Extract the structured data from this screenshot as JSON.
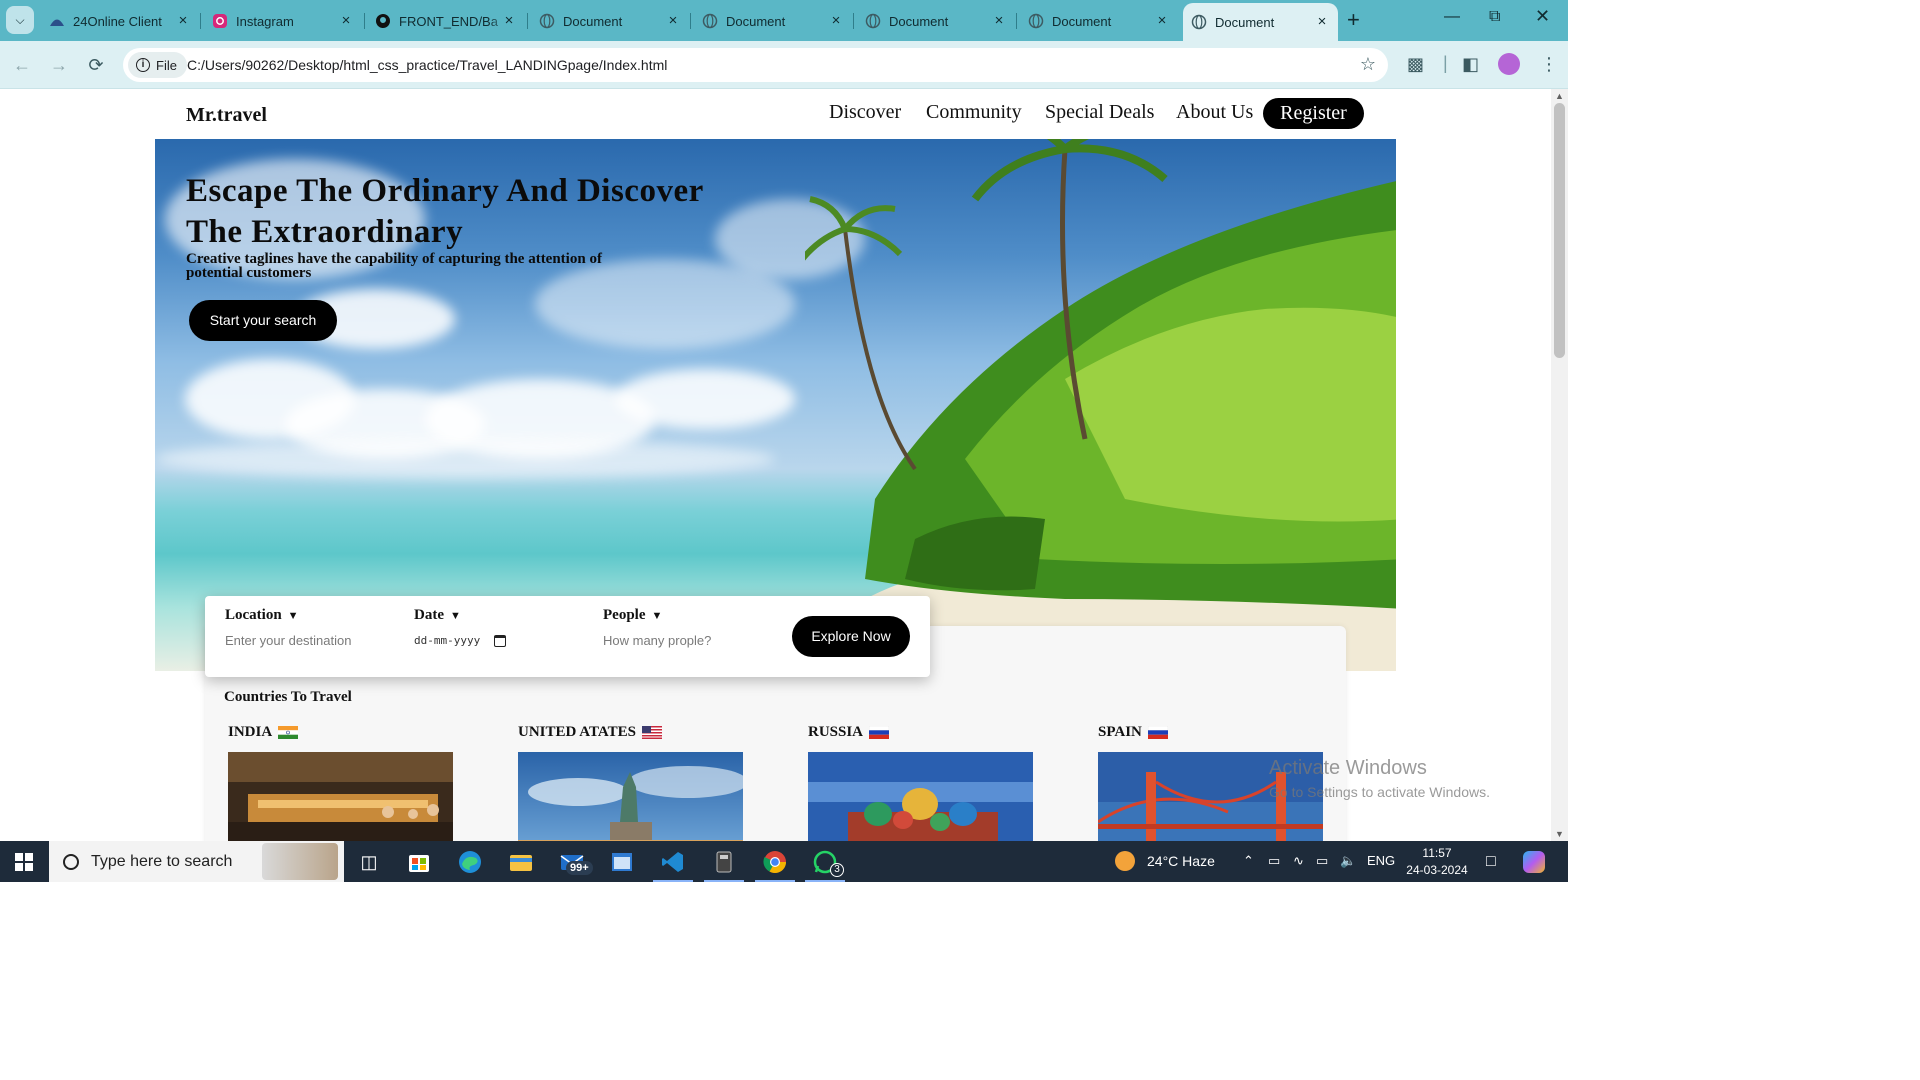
{
  "browser": {
    "tabs": [
      {
        "title": "24Online Client",
        "icon": "globe-icon"
      },
      {
        "title": "Instagram",
        "icon": "instagram-icon"
      },
      {
        "title": "FRONT_END/Ba",
        "icon": "github-icon"
      },
      {
        "title": "Document",
        "icon": "globe-icon"
      },
      {
        "title": "Document",
        "icon": "globe-icon"
      },
      {
        "title": "Document",
        "icon": "globe-icon"
      },
      {
        "title": "Document",
        "icon": "globe-icon"
      },
      {
        "title": "Document",
        "icon": "globe-icon",
        "active": true
      }
    ],
    "security_chip": "File",
    "url": "C:/Users/90262/Desktop/html_css_practice/Travel_LANDINGpage/Index.html"
  },
  "page": {
    "brand": "Mr.travel",
    "nav": [
      "Discover",
      "Community",
      "Special Deals",
      "About Us"
    ],
    "register_label": "Register",
    "hero": {
      "title": "Escape The Ordinary And Discover The Extraordinary",
      "tagline": "Creative taglines have the capability of capturing the attention of potential customers",
      "cta_label": "Start your search"
    },
    "search": {
      "location": {
        "label": "Location",
        "placeholder": "Enter your destination"
      },
      "date": {
        "label": "Date",
        "value": "dd-mm-yyyy"
      },
      "people": {
        "label": "People",
        "placeholder": "How many prople?"
      },
      "explore_label": "Explore Now"
    },
    "countries_title": "Countries To Travel",
    "countries": [
      {
        "name": "INDIA",
        "flag": "india-flag"
      },
      {
        "name": "UNITED ATATES",
        "flag": "usa-flag"
      },
      {
        "name": "RUSSIA",
        "flag": "russia-flag"
      },
      {
        "name": "SPAIN",
        "flag": "russia-flag"
      }
    ]
  },
  "watermark": {
    "line1": "Activate Windows",
    "line2": "Go to Settings to activate Windows."
  },
  "taskbar": {
    "search_placeholder": "Type here to search",
    "mail_badge": "99+",
    "whatsapp_badge": "3",
    "weather": "24°C  Haze",
    "language": "ENG",
    "time": "11:57",
    "date": "24-03-2024"
  },
  "colors": {
    "tabbar": "#5ab7c6",
    "toolbar": "#ddf0f3",
    "button_black": "#000000",
    "taskbar": "#1e2b3a"
  }
}
